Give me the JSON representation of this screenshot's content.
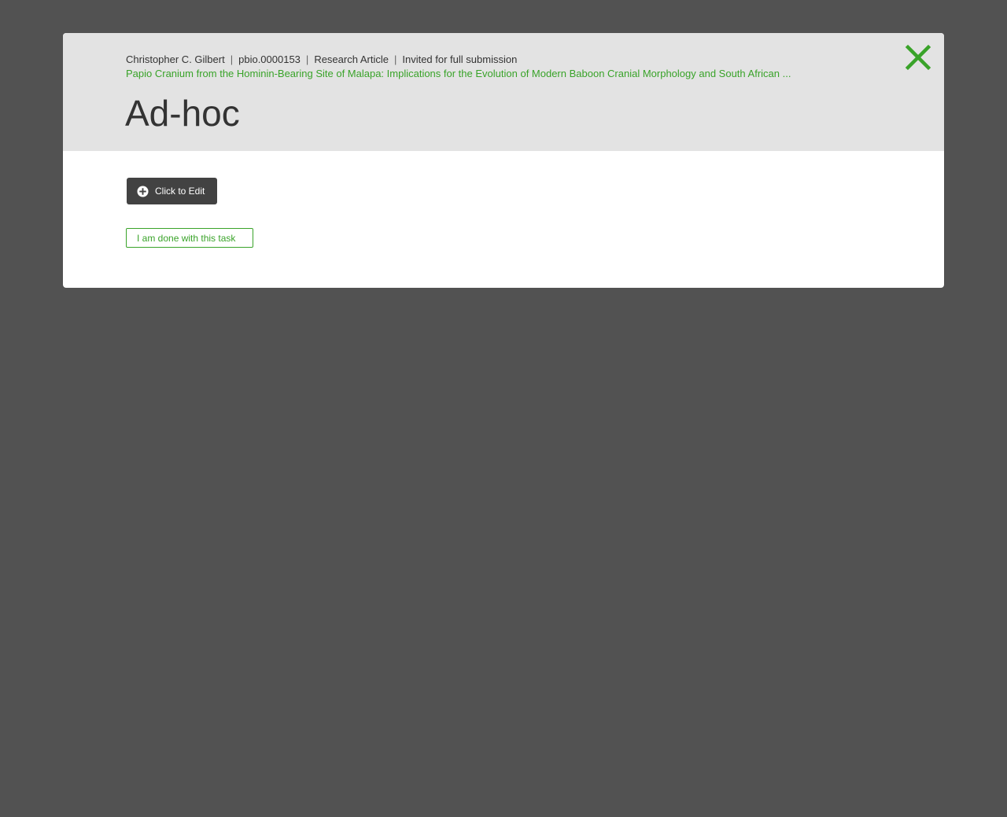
{
  "header": {
    "author": "Christopher C. Gilbert",
    "manuscript_id": "pbio.0000153",
    "article_type": "Research Article",
    "status": "Invited for full submission",
    "separator": "|",
    "paper_title": "Papio Cranium from the Hominin-Bearing Site of Malapa: Implications for the Evolution of Modern Baboon Cranial Morphology and South African ...",
    "task_title": "Ad-hoc",
    "close_icon": "close-icon"
  },
  "body": {
    "edit_button_label": "Click to Edit",
    "edit_button_icon": "plus-circle-icon",
    "done_button_label": "I am done with this task"
  },
  "colors": {
    "accent": "#39a329",
    "overlay": "#525252",
    "header_bg": "#e3e3e3",
    "dark_button": "#424242"
  }
}
